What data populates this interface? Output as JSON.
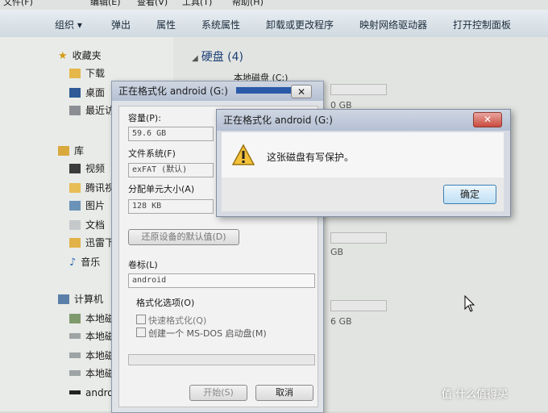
{
  "explorer": {
    "menubar": [
      "文件(F)",
      "编辑(E)",
      "查看(V)",
      "工具(T)",
      "帮助(H)"
    ],
    "toolbar": [
      "组织 ▾",
      "弹出",
      "属性",
      "系统属性",
      "卸载或更改程序",
      "映射网络驱动器",
      "打开控制面板"
    ],
    "nav": {
      "favorites_label": "收藏夹",
      "favorites": [
        "下载",
        "桌面",
        "最近访"
      ],
      "library_label": "库",
      "library": [
        "视频",
        "腾讯视",
        "图片",
        "文档",
        "迅雷下",
        "音乐"
      ],
      "computer_label": "计算机",
      "drives": [
        "本地磁",
        "本地磁",
        "本地磁",
        "本地磁",
        "andro"
      ]
    },
    "content": {
      "section": "硬盘 (4)",
      "drive_c": "本地磁盘 (C:)",
      "partial1": "0 GB",
      "partial2": "GB",
      "partial3": "6 GB"
    }
  },
  "format_dialog": {
    "title": "正在格式化 android (G:)",
    "capacity_label": "容量(P):",
    "capacity_value": "59.6 GB",
    "fs_label": "文件系统(F)",
    "fs_value": "exFAT (默认)",
    "alloc_label": "分配单元大小(A)",
    "alloc_value": "128 KB",
    "restore_button": "还原设备的默认值(D)",
    "volume_label": "卷标(L)",
    "volume_value": "android",
    "options_label": "格式化选项(O)",
    "quick_format": "快速格式化(Q)",
    "msdos": "创建一个 MS-DOS 启动盘(M)",
    "start_button": "开始(S)",
    "cancel_button": "取消"
  },
  "alert": {
    "title": "正在格式化 android (G:)",
    "message": "这张磁盘有写保护。",
    "ok_button": "确定"
  },
  "watermark": "值 什么值得买"
}
